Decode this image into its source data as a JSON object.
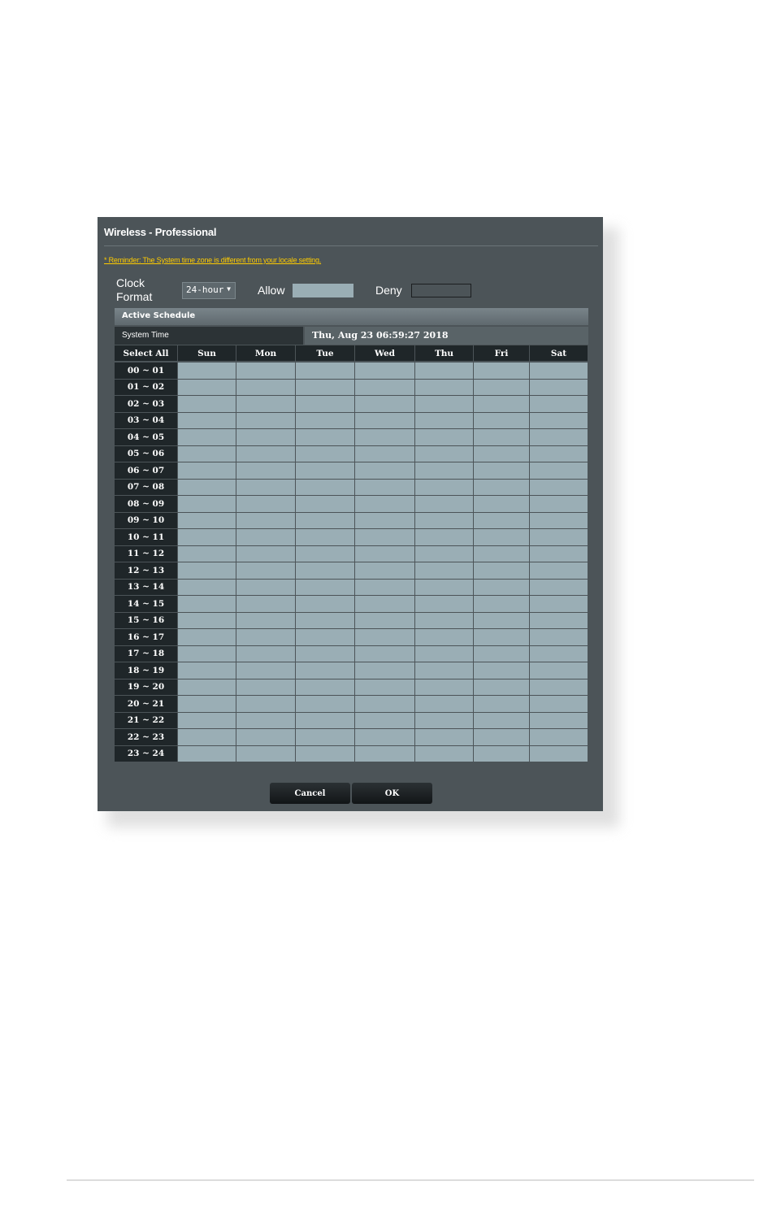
{
  "dialog": {
    "title": "Wireless - Professional",
    "reminder": "* Reminder: The System time zone is different from your locale setting."
  },
  "clock": {
    "label": "Clock Format",
    "format_value": "24-hour",
    "allow_label": "Allow",
    "deny_label": "Deny"
  },
  "schedule": {
    "header": "Active Schedule",
    "system_time_label": "System Time",
    "system_time_value": "Thu, Aug 23 06:59:27 2018",
    "select_all_label": "Select All",
    "days": [
      "Sun",
      "Mon",
      "Tue",
      "Wed",
      "Thu",
      "Fri",
      "Sat"
    ],
    "hours": [
      "00 ~ 01",
      "01 ~ 02",
      "02 ~ 03",
      "03 ~ 04",
      "04 ~ 05",
      "05 ~ 06",
      "06 ~ 07",
      "07 ~ 08",
      "08 ~ 09",
      "09 ~ 10",
      "10 ~ 11",
      "11 ~ 12",
      "12 ~ 13",
      "13 ~ 14",
      "14 ~ 15",
      "15 ~ 16",
      "16 ~ 17",
      "17 ~ 18",
      "18 ~ 19",
      "19 ~ 20",
      "20 ~ 21",
      "21 ~ 22",
      "22 ~ 23",
      "23 ~ 24"
    ]
  },
  "buttons": {
    "cancel": "Cancel",
    "ok": "OK"
  },
  "colors": {
    "dialog_bg": "#4c5458",
    "allow": "#9aaeb5",
    "deny": "#4c5458",
    "reminder": "#ffcc00"
  }
}
